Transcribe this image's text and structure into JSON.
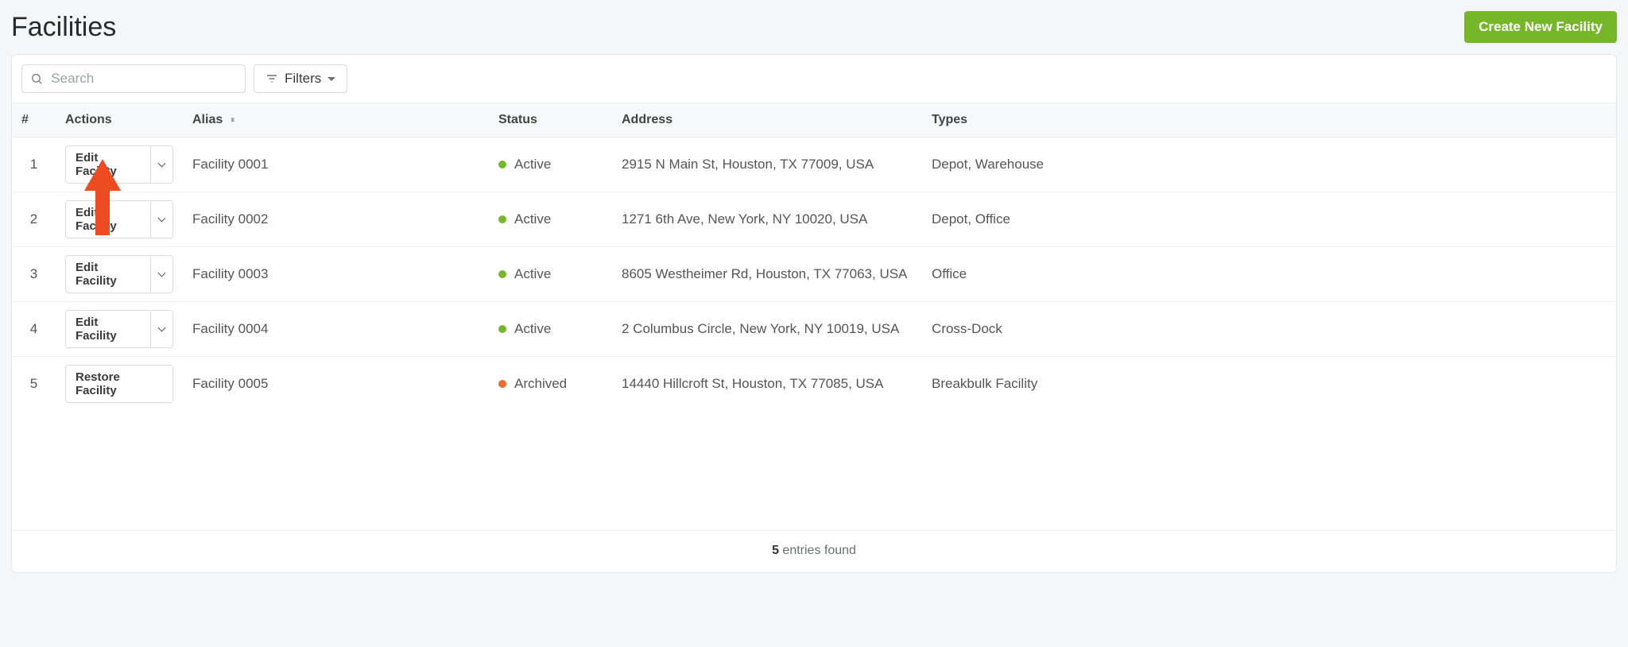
{
  "page_title": "Facilities",
  "create_button_label": "Create New Facility",
  "search_placeholder": "Search",
  "filters_label": "Filters",
  "columns": {
    "num": "#",
    "actions": "Actions",
    "alias": "Alias",
    "status": "Status",
    "address": "Address",
    "types": "Types"
  },
  "edit_label": "Edit Facility",
  "restore_label": "Restore Facility",
  "status_labels": {
    "active": "Active",
    "archived": "Archived"
  },
  "rows": [
    {
      "num": "1",
      "action": "edit",
      "alias": "Facility 0001",
      "status": "active",
      "address": "2915 N Main St, Houston, TX 77009, USA",
      "types": "Depot, Warehouse"
    },
    {
      "num": "2",
      "action": "edit",
      "alias": "Facility 0002",
      "status": "active",
      "address": "1271 6th Ave, New York, NY 10020, USA",
      "types": "Depot, Office"
    },
    {
      "num": "3",
      "action": "edit",
      "alias": "Facility 0003",
      "status": "active",
      "address": "8605 Westheimer Rd, Houston, TX 77063, USA",
      "types": "Office"
    },
    {
      "num": "4",
      "action": "edit",
      "alias": "Facility 0004",
      "status": "active",
      "address": "2 Columbus Circle, New York, NY 10019, USA",
      "types": "Cross-Dock"
    },
    {
      "num": "5",
      "action": "restore",
      "alias": "Facility 0005",
      "status": "archived",
      "address": "14440 Hillcroft St, Houston, TX 77085, USA",
      "types": "Breakbulk Facility"
    }
  ],
  "footer": {
    "count": "5",
    "suffix": " entries found"
  },
  "colors": {
    "primary": "#76b72a",
    "active_dot": "#76b72a",
    "archived_dot": "#f06a2d",
    "annotation_arrow": "#ef4b23"
  }
}
